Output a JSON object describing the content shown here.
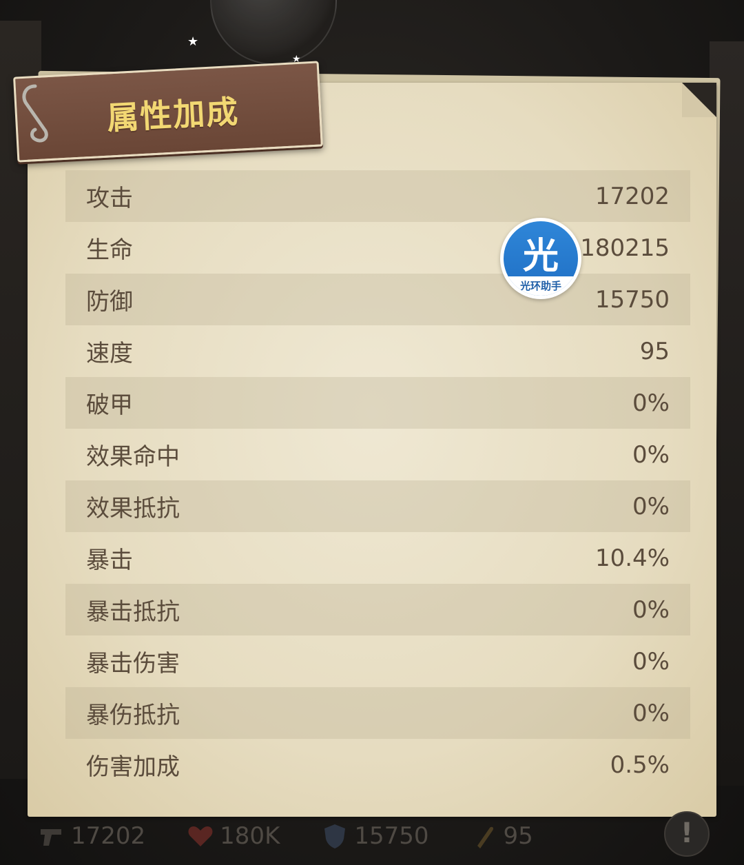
{
  "title": "属性加成",
  "stats": [
    {
      "label": "攻击",
      "value": "17202"
    },
    {
      "label": "生命",
      "value": "180215"
    },
    {
      "label": "防御",
      "value": "15750"
    },
    {
      "label": "速度",
      "value": "95"
    },
    {
      "label": "破甲",
      "value": "0%"
    },
    {
      "label": "效果命中",
      "value": "0%"
    },
    {
      "label": "效果抵抗",
      "value": "0%"
    },
    {
      "label": "暴击",
      "value": "10.4%"
    },
    {
      "label": "暴击抵抗",
      "value": "0%"
    },
    {
      "label": "暴击伤害",
      "value": "0%"
    },
    {
      "label": "暴伤抵抗",
      "value": "0%"
    },
    {
      "label": "伤害加成",
      "value": "0.5%"
    }
  ],
  "badge": {
    "char": "光",
    "caption": "光环助手"
  },
  "bottom_bar": [
    {
      "icon": "gun-icon",
      "value": "17202"
    },
    {
      "icon": "heart-icon",
      "value": "180K"
    },
    {
      "icon": "shield-icon",
      "value": "15750"
    },
    {
      "icon": "bullet-icon",
      "value": "95"
    }
  ],
  "help": "!",
  "colors": {
    "title": "#f2d873",
    "plank": "#6a4636",
    "paper": "#e6dcc0",
    "badge": "#1f6fc4"
  }
}
